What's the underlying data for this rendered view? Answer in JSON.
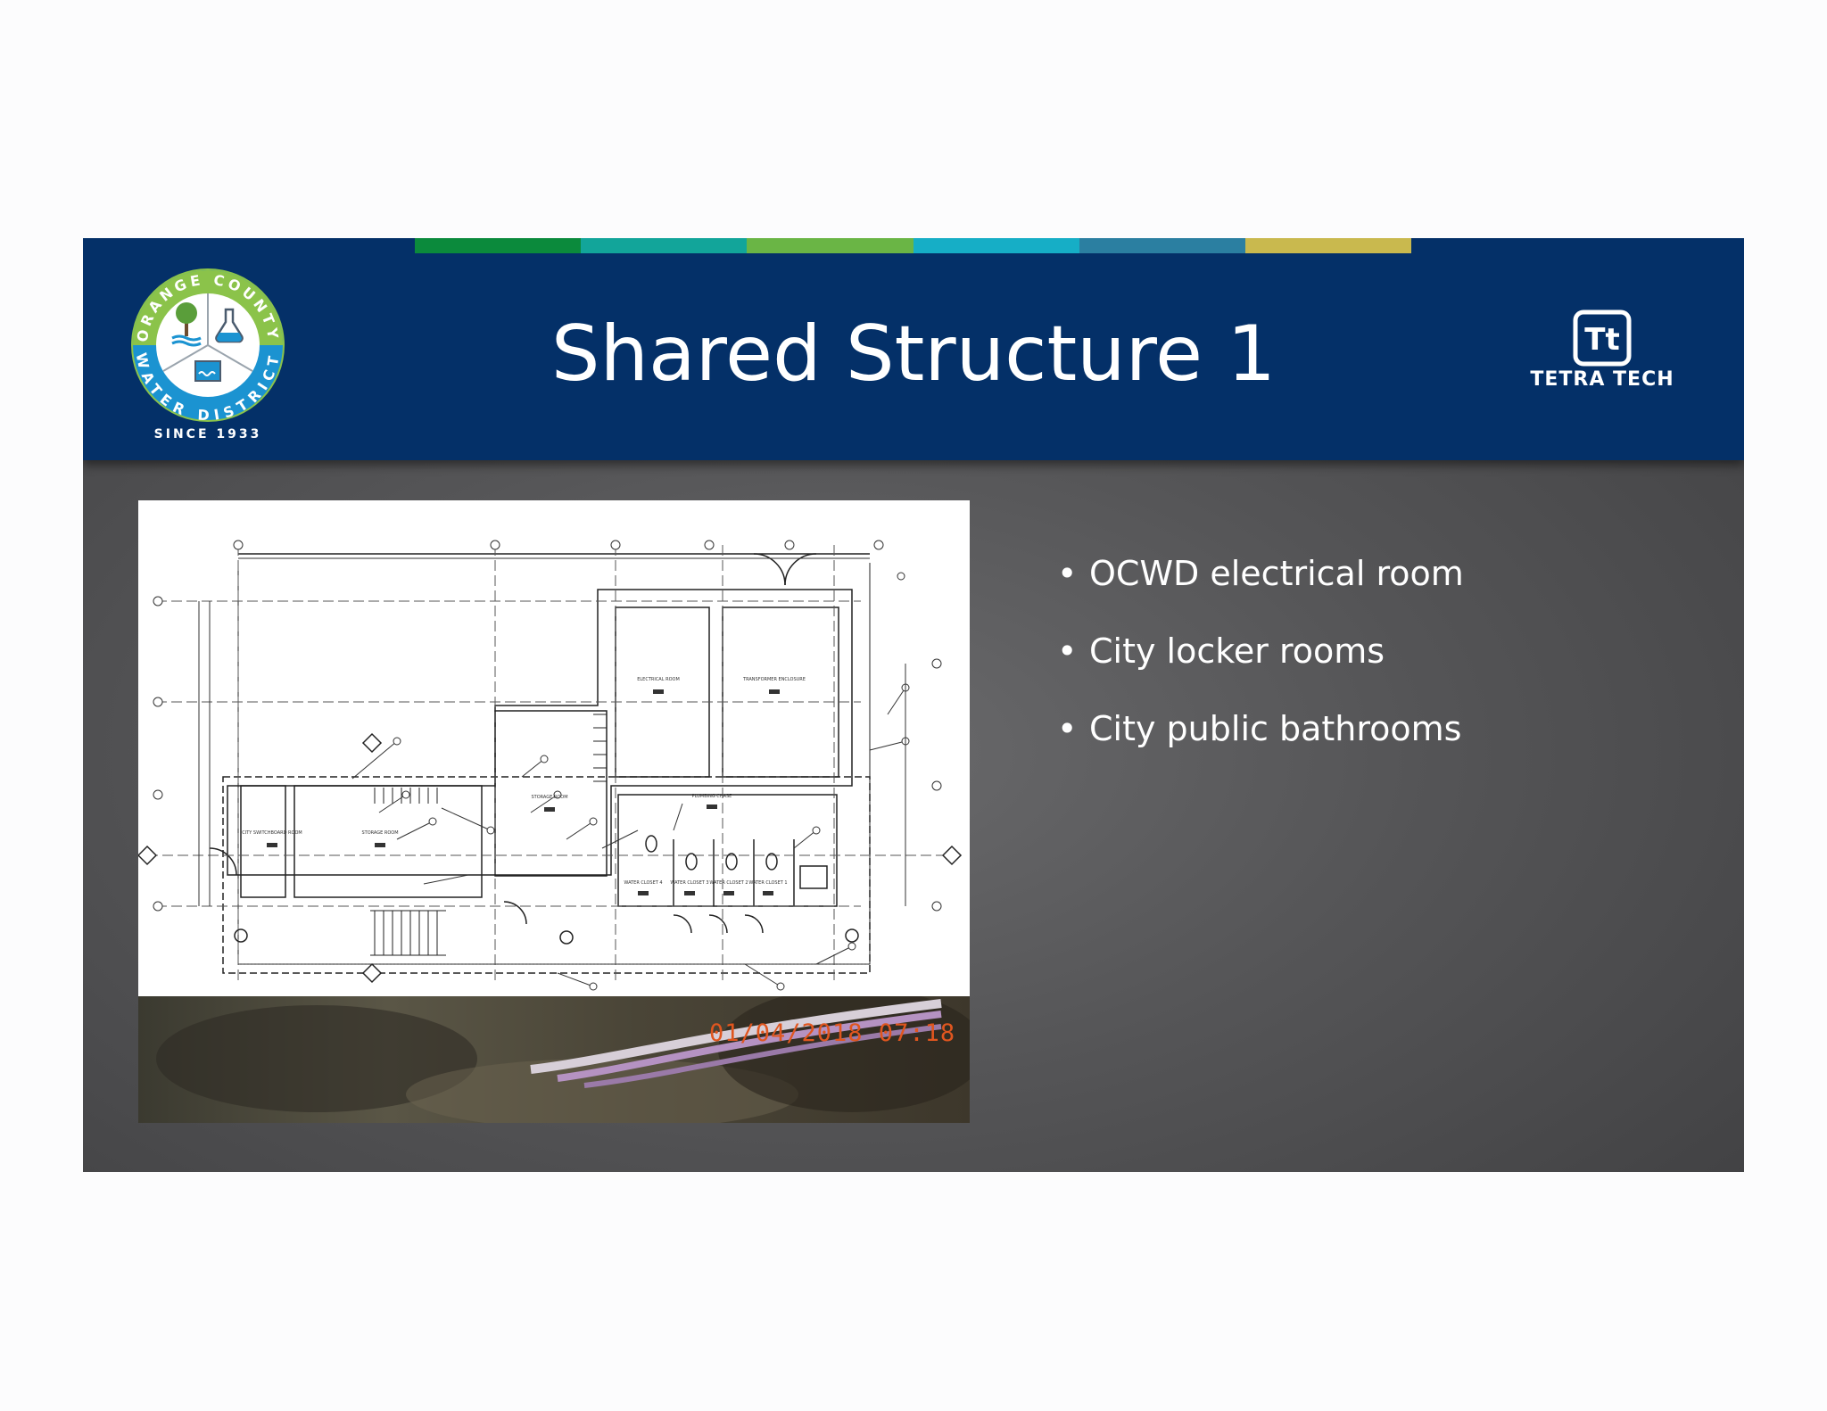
{
  "slide": {
    "title": "Shared Structure 1",
    "stripes": [
      "#0b8a3c",
      "#12a59a",
      "#6ab545",
      "#16aec6",
      "#2b7fa1",
      "#c9b94e"
    ],
    "header_color": "#043068"
  },
  "logo_left": {
    "ring_top": "ORANGE COUNTY",
    "ring_bottom": "WATER DISTRICT",
    "since": "SINCE 1933"
  },
  "logo_right": {
    "mark": "Tt",
    "name": "TETRA TECH"
  },
  "floor_plan": {
    "rooms": [
      "ELECTRICAL ROOM",
      "TRANSFORMER ENCLOSURE",
      "STORAGE ROOM",
      "CITY SWITCHBOARD ROOM",
      "STORAGE ROOM",
      "PLUMBING CHASE",
      "WATER CLOSET 4",
      "WATER CLOSET 3",
      "WATER CLOSET 2",
      "WATER CLOSET 1"
    ]
  },
  "photo": {
    "timestamp": "01/04/2018 07:18"
  },
  "bullets": [
    {
      "bullet": "•",
      "text": "OCWD electrical room"
    },
    {
      "bullet": "•",
      "text": "City locker rooms"
    },
    {
      "bullet": "•",
      "text": "City public bathrooms"
    }
  ]
}
